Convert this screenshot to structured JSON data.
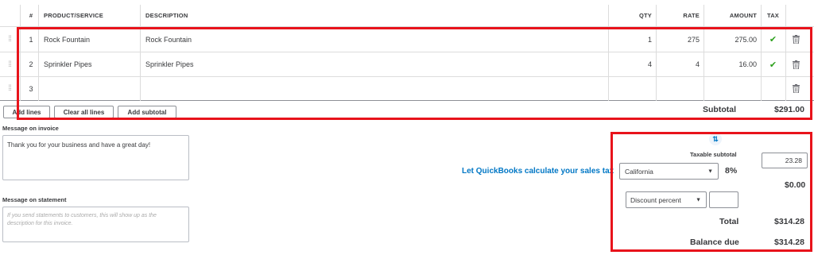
{
  "table": {
    "headers": {
      "num": "#",
      "product": "PRODUCT/SERVICE",
      "description": "DESCRIPTION",
      "qty": "QTY",
      "rate": "RATE",
      "amount": "AMOUNT",
      "tax": "TAX"
    },
    "rows": [
      {
        "num": "1",
        "product": "Rock Fountain",
        "description": "Rock Fountain",
        "qty": "1",
        "rate": "275",
        "amount": "275.00",
        "tax_check": "✔"
      },
      {
        "num": "2",
        "product": "Sprinkler Pipes",
        "description": "Sprinkler Pipes",
        "qty": "4",
        "rate": "4",
        "amount": "16.00",
        "tax_check": "✔"
      },
      {
        "num": "3",
        "product": "",
        "description": "",
        "qty": "",
        "rate": "",
        "amount": "",
        "tax_check": ""
      }
    ]
  },
  "buttons": {
    "add_lines": "Add lines",
    "clear_all_lines": "Clear all lines",
    "add_subtotal": "Add subtotal"
  },
  "subtotal": {
    "label": "Subtotal",
    "value": "$291.00"
  },
  "message_invoice": {
    "label": "Message on invoice",
    "value": "Thank you for your business and have a great day!"
  },
  "message_statement": {
    "label": "Message on statement",
    "placeholder": "If you send statements to customers, this will show up as the description for this invoice."
  },
  "sales_tax": {
    "link": "Let QuickBooks calculate your sales tax",
    "taxable_label": "Taxable subtotal",
    "taxable_value": "23.28",
    "location": "California",
    "rate": "8%",
    "tax_amount": "$0.00"
  },
  "discount": {
    "type": "Discount percent",
    "value": ""
  },
  "totals": {
    "total_label": "Total",
    "total_value": "$314.28",
    "balance_label": "Balance due",
    "balance_value": "$314.28"
  },
  "colors": {
    "highlight": "#e8131b",
    "link": "#0077c5",
    "check": "#2ca01c"
  }
}
